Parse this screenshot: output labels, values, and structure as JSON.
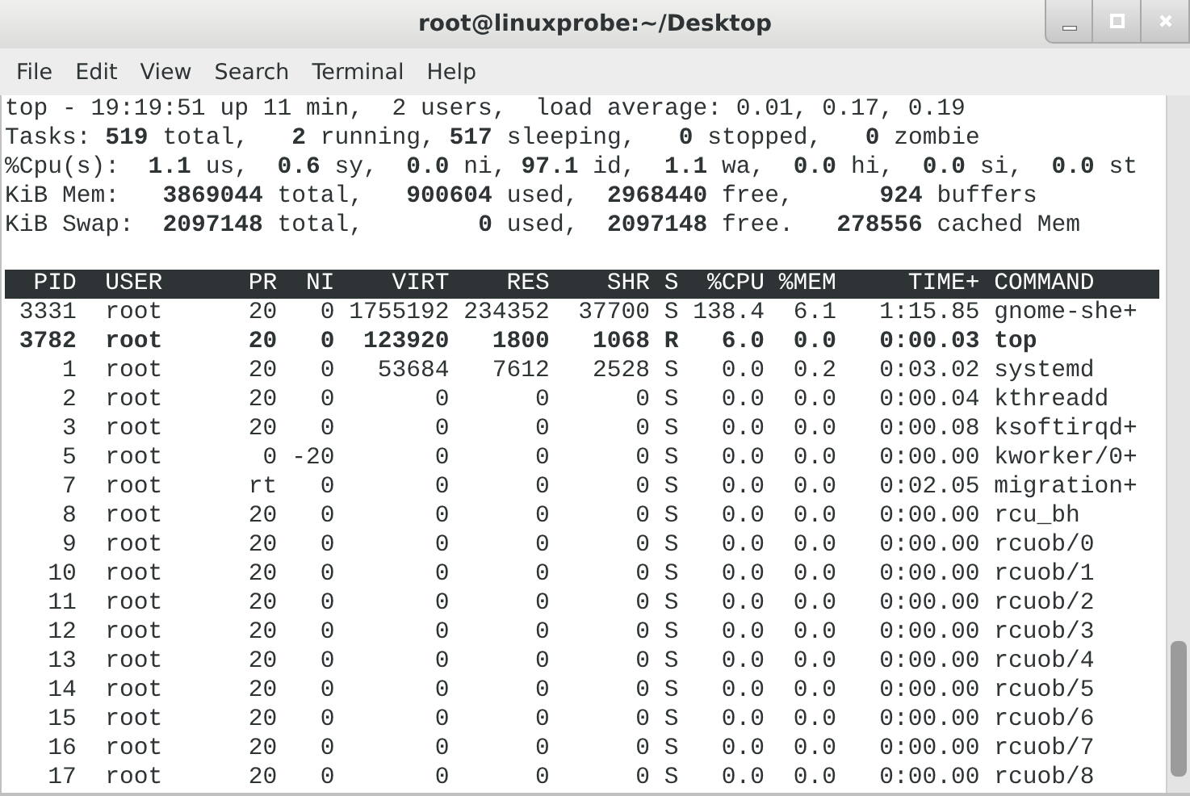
{
  "window": {
    "title": "root@linuxprobe:~/Desktop"
  },
  "menu": [
    "File",
    "Edit",
    "View",
    "Search",
    "Terminal",
    "Help"
  ],
  "summary": [
    "top - 19:19:51 up 11 min,  2 users,  load average: 0.01, 0.17, 0.19",
    "Tasks: **519** total,   **2** running, **517** sleeping,   **0** stopped,   **0** zombie",
    "%Cpu(s):  **1.1** us,  **0.6** sy,  **0.0** ni, **97.1** id,  **1.1** wa,  **0.0** hi,  **0.0** si,  **0.0** st",
    "KiB Mem:   **3869044** total,   **900604** used,  **2968440** free,      **924** buffers",
    "KiB Swap:  **2097148** total,        **0** used,  **2097148** free.   **278556** cached Mem"
  ],
  "table": {
    "columns": [
      "PID",
      "USER",
      "PR",
      "NI",
      "VIRT",
      "RES",
      "SHR",
      "S",
      "%CPU",
      "%MEM",
      "TIME+",
      "COMMAND"
    ],
    "rows": [
      {
        "highlighted": false,
        "cells": [
          "3331",
          "root",
          "20",
          "0",
          "1755192",
          "234352",
          "37700",
          "S",
          "138.4",
          "6.1",
          "1:15.85",
          "gnome-she+"
        ]
      },
      {
        "highlighted": true,
        "cells": [
          "3782",
          "root",
          "20",
          "0",
          "123920",
          "1800",
          "1068",
          "R",
          "6.0",
          "0.0",
          "0:00.03",
          "top"
        ]
      },
      {
        "highlighted": false,
        "cells": [
          "1",
          "root",
          "20",
          "0",
          "53684",
          "7612",
          "2528",
          "S",
          "0.0",
          "0.2",
          "0:03.02",
          "systemd"
        ]
      },
      {
        "highlighted": false,
        "cells": [
          "2",
          "root",
          "20",
          "0",
          "0",
          "0",
          "0",
          "S",
          "0.0",
          "0.0",
          "0:00.04",
          "kthreadd"
        ]
      },
      {
        "highlighted": false,
        "cells": [
          "3",
          "root",
          "20",
          "0",
          "0",
          "0",
          "0",
          "S",
          "0.0",
          "0.0",
          "0:00.08",
          "ksoftirqd+"
        ]
      },
      {
        "highlighted": false,
        "cells": [
          "5",
          "root",
          "0",
          "-20",
          "0",
          "0",
          "0",
          "S",
          "0.0",
          "0.0",
          "0:00.00",
          "kworker/0+"
        ]
      },
      {
        "highlighted": false,
        "cells": [
          "7",
          "root",
          "rt",
          "0",
          "0",
          "0",
          "0",
          "S",
          "0.0",
          "0.0",
          "0:02.05",
          "migration+"
        ]
      },
      {
        "highlighted": false,
        "cells": [
          "8",
          "root",
          "20",
          "0",
          "0",
          "0",
          "0",
          "S",
          "0.0",
          "0.0",
          "0:00.00",
          "rcu_bh"
        ]
      },
      {
        "highlighted": false,
        "cells": [
          "9",
          "root",
          "20",
          "0",
          "0",
          "0",
          "0",
          "S",
          "0.0",
          "0.0",
          "0:00.00",
          "rcuob/0"
        ]
      },
      {
        "highlighted": false,
        "cells": [
          "10",
          "root",
          "20",
          "0",
          "0",
          "0",
          "0",
          "S",
          "0.0",
          "0.0",
          "0:00.00",
          "rcuob/1"
        ]
      },
      {
        "highlighted": false,
        "cells": [
          "11",
          "root",
          "20",
          "0",
          "0",
          "0",
          "0",
          "S",
          "0.0",
          "0.0",
          "0:00.00",
          "rcuob/2"
        ]
      },
      {
        "highlighted": false,
        "cells": [
          "12",
          "root",
          "20",
          "0",
          "0",
          "0",
          "0",
          "S",
          "0.0",
          "0.0",
          "0:00.00",
          "rcuob/3"
        ]
      },
      {
        "highlighted": false,
        "cells": [
          "13",
          "root",
          "20",
          "0",
          "0",
          "0",
          "0",
          "S",
          "0.0",
          "0.0",
          "0:00.00",
          "rcuob/4"
        ]
      },
      {
        "highlighted": false,
        "cells": [
          "14",
          "root",
          "20",
          "0",
          "0",
          "0",
          "0",
          "S",
          "0.0",
          "0.0",
          "0:00.00",
          "rcuob/5"
        ]
      },
      {
        "highlighted": false,
        "cells": [
          "15",
          "root",
          "20",
          "0",
          "0",
          "0",
          "0",
          "S",
          "0.0",
          "0.0",
          "0:00.00",
          "rcuob/6"
        ]
      },
      {
        "highlighted": false,
        "cells": [
          "16",
          "root",
          "20",
          "0",
          "0",
          "0",
          "0",
          "S",
          "0.0",
          "0.0",
          "0:00.00",
          "rcuob/7"
        ]
      },
      {
        "highlighted": false,
        "cells": [
          "17",
          "root",
          "20",
          "0",
          "0",
          "0",
          "0",
          "S",
          "0.0",
          "0.0",
          "0:00.00",
          "rcuob/8"
        ]
      }
    ]
  }
}
